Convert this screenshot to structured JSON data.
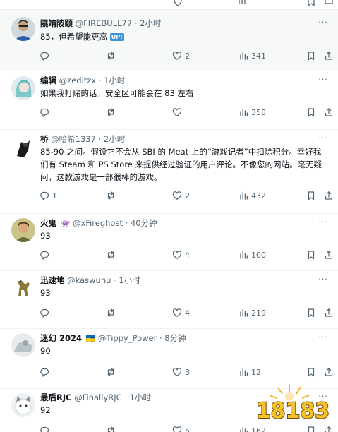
{
  "tweets": [
    {
      "name": "隰靖陂颐",
      "handle": "@FIREBULL77",
      "sep": "·",
      "time": "2小时",
      "badge": "",
      "text": "85，但希望能更高",
      "emoji": "UP!",
      "replies": "",
      "retweets": "",
      "likes": "2",
      "views": "341"
    },
    {
      "name": "编辑",
      "handle": "@zeditzx",
      "sep": "·",
      "time": "1小时",
      "badge": "",
      "text": "如果我打赌的话，安全区可能会在 83 左右",
      "emoji": "",
      "replies": "",
      "retweets": "",
      "likes": "",
      "views": "358"
    },
    {
      "name": "桥",
      "handle": "@哈希1337",
      "sep": "·",
      "time": "2小时",
      "badge": "",
      "text": "85-90 之间。假设它不会从 SBI 的 Meat 上的“游戏记者”中扣除积分。幸好我们有 Steam 和 PS Store 来提供经过验证的用户评论。不像您的网站。毫无疑问，这款游戏是一部很棒的游戏。",
      "emoji": "",
      "replies": "1",
      "retweets": "",
      "likes": "2",
      "views": "432"
    },
    {
      "name": "火鬼",
      "handle": "@xFireghost",
      "sep": "·",
      "time": "40分钟",
      "badge": "👾",
      "text": "93",
      "emoji": "",
      "replies": "",
      "retweets": "",
      "likes": "4",
      "views": "100"
    },
    {
      "name": "迅速地",
      "handle": "@kaswuhu",
      "sep": "·",
      "time": "1小时",
      "badge": "",
      "text": "93",
      "emoji": "",
      "replies": "",
      "retweets": "",
      "likes": "4",
      "views": "219"
    },
    {
      "name": "迷幻 2024",
      "handle": "@Tippy_Power",
      "sep": "·",
      "time": "8分钟",
      "badge": "🇺🇦",
      "text": "90",
      "emoji": "",
      "replies": "",
      "retweets": "",
      "likes": "3",
      "views": "12"
    },
    {
      "name": "最后RJC",
      "handle": "@FinallyRJC",
      "sep": "·",
      "time": "1小时",
      "badge": "",
      "text": "92",
      "emoji": "",
      "replies": "",
      "retweets": "",
      "likes": "5",
      "views": "162"
    }
  ],
  "watermark": {
    "text": "18183"
  },
  "colors": {
    "text": "#0f1419",
    "muted": "#536471",
    "divider": "#eff3f4",
    "accent": "#1d9bf0"
  },
  "icons": [
    "reply-icon",
    "retweet-icon",
    "like-icon",
    "views-icon",
    "bookmark-icon",
    "share-icon",
    "more-icon"
  ]
}
